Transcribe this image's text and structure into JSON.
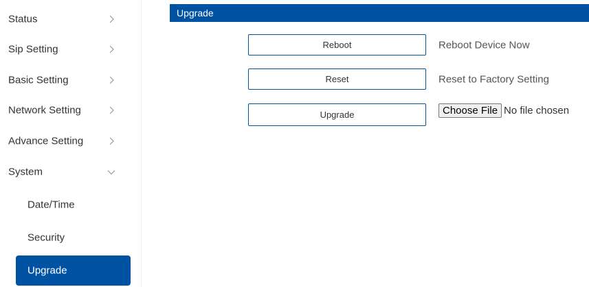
{
  "sidebar": {
    "items": [
      {
        "label": "Status",
        "icon": "chevron-right-icon"
      },
      {
        "label": "Sip Setting",
        "icon": "chevron-right-icon"
      },
      {
        "label": "Basic Setting",
        "icon": "chevron-right-icon"
      },
      {
        "label": "Network Setting",
        "icon": "chevron-right-icon"
      },
      {
        "label": "Advance Setting",
        "icon": "chevron-right-icon"
      },
      {
        "label": "System",
        "icon": "chevron-down-icon",
        "expanded": true
      }
    ],
    "subitems": [
      {
        "label": "Date/Time",
        "active": false
      },
      {
        "label": "Security",
        "active": false
      },
      {
        "label": "Upgrade",
        "active": true
      }
    ],
    "active_color": "#0052a3"
  },
  "header": {
    "title": "Upgrade",
    "color": "#0052a3"
  },
  "actions": {
    "reboot": {
      "button": "Reboot",
      "description": "Reboot Device Now"
    },
    "reset": {
      "button": "Reset",
      "description": "Reset to Factory Setting"
    },
    "upgrade": {
      "button": "Upgrade",
      "file_button": "Choose File",
      "file_status": "No file chosen"
    }
  }
}
